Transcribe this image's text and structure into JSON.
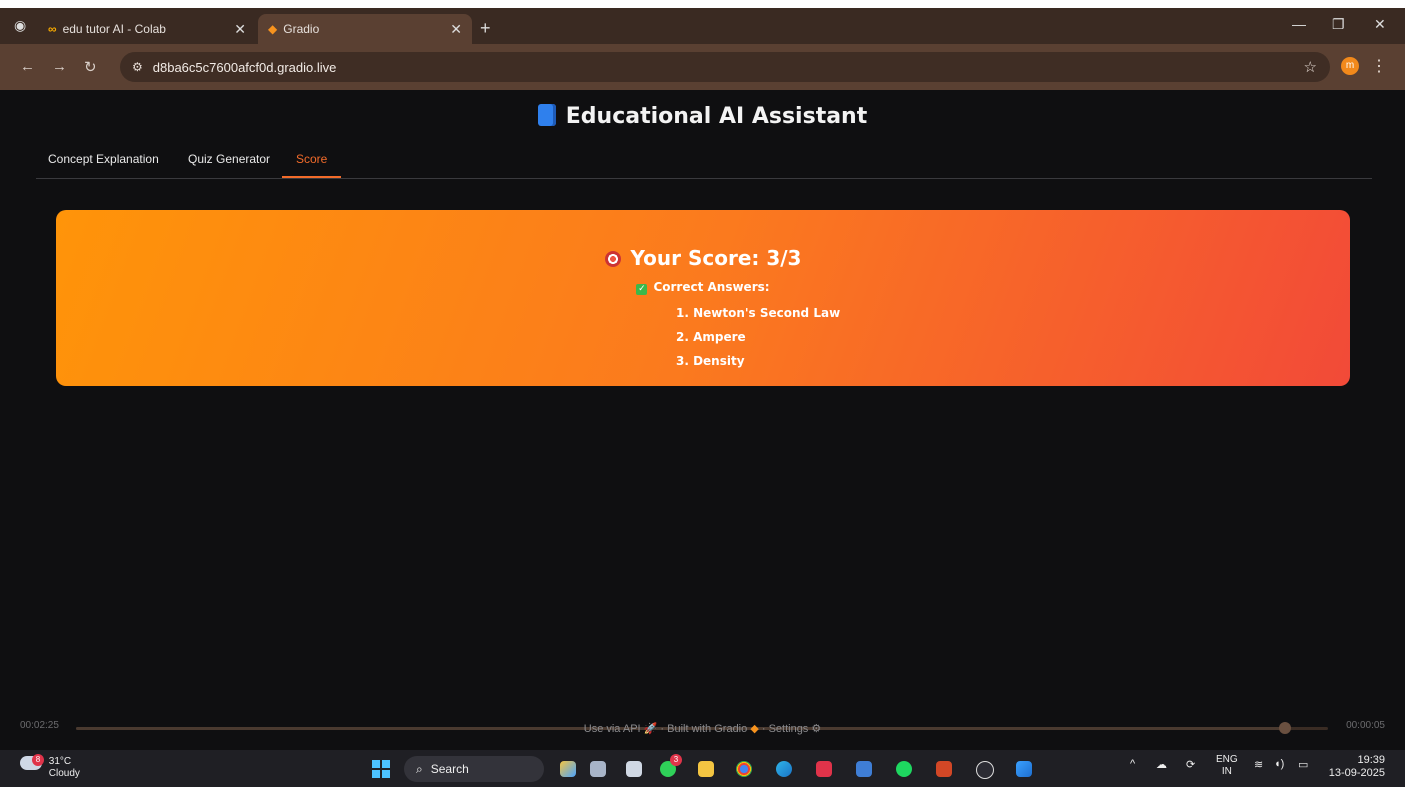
{
  "browser": {
    "tabs": [
      {
        "label": "edu tutor AI - Colab",
        "icon": "colab-icon",
        "active": false
      },
      {
        "label": "Gradio",
        "icon": "gradio-icon",
        "active": true
      }
    ],
    "url": "d8ba6c5c7600afcf0d.gradio.live",
    "profile_initial": "m"
  },
  "app": {
    "title": "Educational AI Assistant",
    "tabs": [
      "Concept Explanation",
      "Quiz Generator",
      "Score"
    ],
    "active_tab": "Score",
    "score_card": {
      "title": "Your Score: 3/3",
      "correct_heading": "Correct Answers:",
      "answers": [
        "1. Newton's Second Law",
        "2. Ampere",
        "3. Density"
      ]
    },
    "footer": {
      "use_api": "Use via API",
      "built_with": "Built with Gradio",
      "settings": "Settings"
    }
  },
  "player": {
    "elapsed": "00:02:25",
    "remaining": "00:00:05",
    "progress": 0.966
  },
  "taskbar": {
    "weather_temp": "31°C",
    "weather_desc": "Cloudy",
    "weather_badge": "8",
    "search_label": "Search",
    "whatsapp_badge": "3",
    "lang_top": "ENG",
    "lang_bottom": "IN",
    "time": "19:39",
    "date": "13-09-2025"
  },
  "colors": {
    "accent": "#f26b2a",
    "card_start": "#ff9409",
    "card_end": "#f24a38"
  }
}
